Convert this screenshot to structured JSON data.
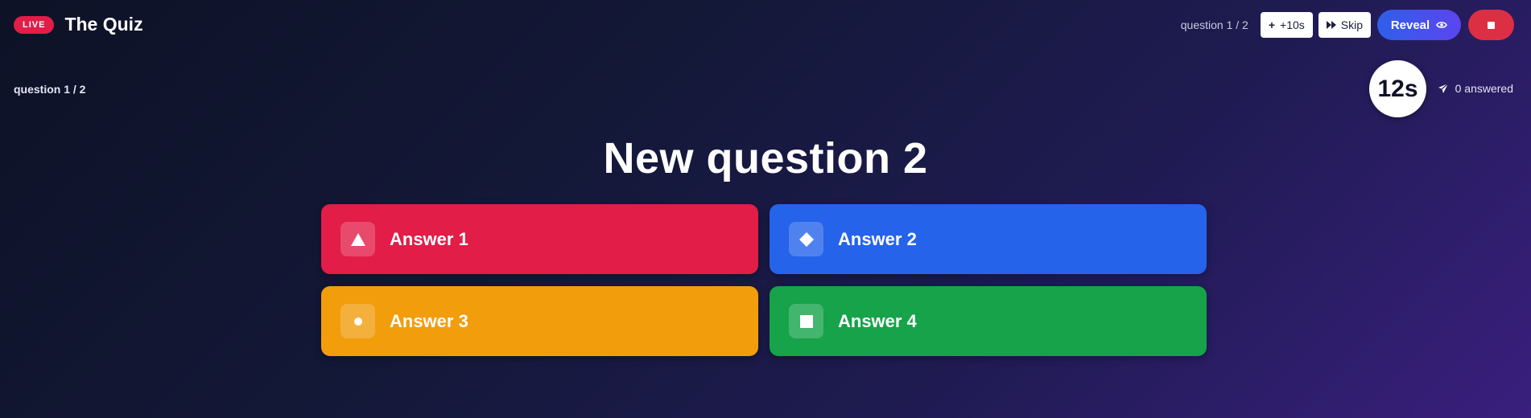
{
  "header": {
    "live_badge": "LIVE",
    "title": "The Quiz",
    "progress": "question 1 / 2",
    "add_time_label": "+10s",
    "skip_label": "Skip",
    "reveal_label": "Reveal"
  },
  "status": {
    "progress": "question 1 / 2",
    "timer": "12s",
    "answered": "0 answered"
  },
  "question": {
    "text": "New question 2"
  },
  "answers": [
    {
      "label": "Answer 1",
      "color": "#e11d48",
      "icon": "triangle-icon"
    },
    {
      "label": "Answer 2",
      "color": "#2563eb",
      "icon": "diamond-icon"
    },
    {
      "label": "Answer 3",
      "color": "#f29d0c",
      "icon": "circle-icon"
    },
    {
      "label": "Answer 4",
      "color": "#16a34a",
      "icon": "square-icon"
    }
  ],
  "colors": {
    "live": "#e11d48",
    "stop": "#dc2f43",
    "reveal_start": "#2f5fe8",
    "reveal_end": "#5b45f0"
  }
}
